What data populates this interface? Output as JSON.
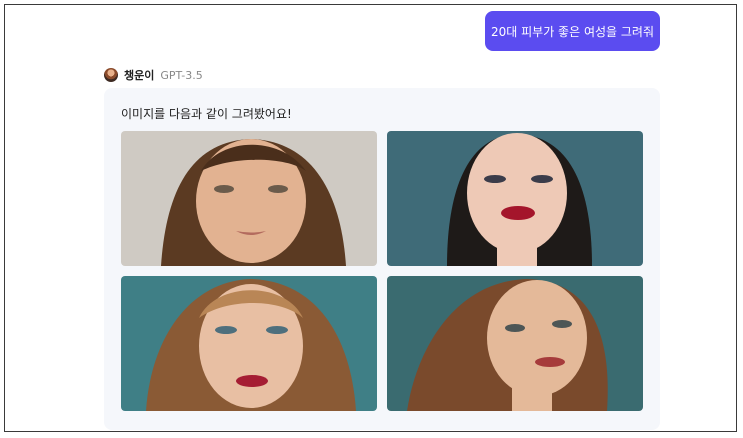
{
  "user_message": "20대 피부가 좋은 여성을 그려줘",
  "bot": {
    "name": "챙운이",
    "model": "GPT-3.5",
    "reply": "이미지를 다음과 같이 그려봤어요!"
  },
  "images": [
    {
      "icon": "portrait-image"
    },
    {
      "icon": "portrait-image"
    },
    {
      "icon": "portrait-image"
    },
    {
      "icon": "portrait-image"
    }
  ]
}
